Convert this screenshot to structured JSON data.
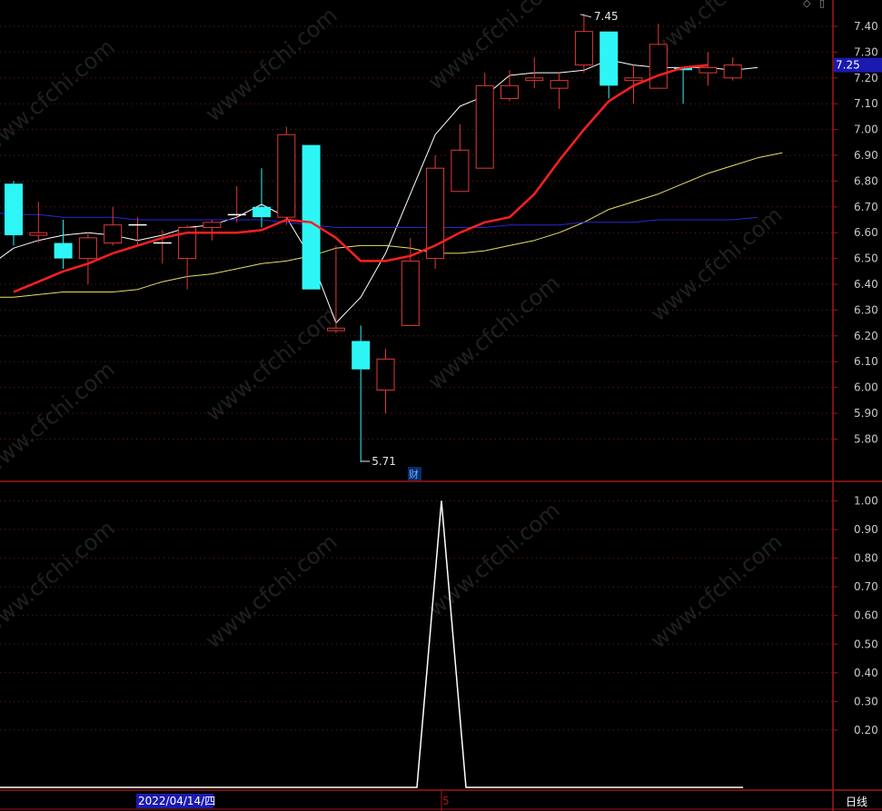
{
  "chart_data": [
    {
      "type": "candlestick",
      "panel": "price",
      "ylim": [
        5.7,
        7.5
      ],
      "yticks": [
        "7.40",
        "7.30",
        "7.20",
        "7.10",
        "7.00",
        "6.90",
        "6.80",
        "6.70",
        "6.60",
        "6.50",
        "6.40",
        "6.30",
        "6.20",
        "6.10",
        "6.00",
        "5.90",
        "5.80"
      ],
      "last_price_label": "7.25",
      "max_label": "7.45",
      "min_label": "5.71",
      "event_badge": "财",
      "candles": [
        {
          "o": 6.79,
          "h": 6.8,
          "l": 6.55,
          "c": 6.59
        },
        {
          "o": 6.59,
          "h": 6.72,
          "l": 6.56,
          "c": 6.6
        },
        {
          "o": 6.56,
          "h": 6.65,
          "l": 6.46,
          "c": 6.5
        },
        {
          "o": 6.5,
          "h": 6.6,
          "l": 6.4,
          "c": 6.58
        },
        {
          "o": 6.56,
          "h": 6.7,
          "l": 6.55,
          "c": 6.63
        },
        {
          "o": 6.63,
          "h": 6.66,
          "l": 6.55,
          "c": 6.63
        },
        {
          "o": 6.56,
          "h": 6.61,
          "l": 6.48,
          "c": 6.56
        },
        {
          "o": 6.5,
          "h": 6.63,
          "l": 6.38,
          "c": 6.62
        },
        {
          "o": 6.62,
          "h": 6.65,
          "l": 6.57,
          "c": 6.64
        },
        {
          "o": 6.67,
          "h": 6.78,
          "l": 6.64,
          "c": 6.67
        },
        {
          "o": 6.7,
          "h": 6.85,
          "l": 6.62,
          "c": 6.66
        },
        {
          "o": 6.66,
          "h": 7.01,
          "l": 6.63,
          "c": 6.98
        },
        {
          "o": 6.94,
          "h": 6.94,
          "l": 6.38,
          "c": 6.38
        },
        {
          "o": 6.22,
          "h": 6.55,
          "l": 6.21,
          "c": 6.23
        },
        {
          "o": 6.18,
          "h": 6.24,
          "l": 5.71,
          "c": 6.07
        },
        {
          "o": 5.99,
          "h": 6.15,
          "l": 5.9,
          "c": 6.11
        },
        {
          "o": 6.24,
          "h": 6.58,
          "l": 6.24,
          "c": 6.49
        },
        {
          "o": 6.5,
          "h": 6.9,
          "l": 6.46,
          "c": 6.85
        },
        {
          "o": 6.76,
          "h": 7.02,
          "l": 6.76,
          "c": 6.92
        },
        {
          "o": 6.85,
          "h": 7.22,
          "l": 6.85,
          "c": 7.17
        },
        {
          "o": 7.12,
          "h": 7.23,
          "l": 7.11,
          "c": 7.17
        },
        {
          "o": 7.19,
          "h": 7.28,
          "l": 7.16,
          "c": 7.2
        },
        {
          "o": 7.16,
          "h": 7.22,
          "l": 7.08,
          "c": 7.19
        },
        {
          "o": 7.25,
          "h": 7.45,
          "l": 7.22,
          "c": 7.38
        },
        {
          "o": 7.38,
          "h": 7.38,
          "l": 7.12,
          "c": 7.17
        },
        {
          "o": 7.19,
          "h": 7.25,
          "l": 7.1,
          "c": 7.2
        },
        {
          "o": 7.16,
          "h": 7.41,
          "l": 7.16,
          "c": 7.33
        },
        {
          "o": 7.24,
          "h": 7.24,
          "l": 7.1,
          "c": 7.23
        },
        {
          "o": 7.22,
          "h": 7.3,
          "l": 7.17,
          "c": 7.24
        },
        {
          "o": 7.2,
          "h": 7.28,
          "l": 7.19,
          "c": 7.25
        }
      ],
      "series": [
        {
          "color": "#ffffff",
          "width": 1,
          "values": [
            6.47,
            6.54,
            6.57,
            6.59,
            6.6,
            6.59,
            6.57,
            6.59,
            6.62,
            6.63,
            6.66,
            6.71,
            6.66,
            6.5,
            6.25,
            6.35,
            6.52,
            6.75,
            6.98,
            7.09,
            7.13,
            7.21,
            7.22,
            7.22,
            7.23,
            7.27,
            7.25,
            7.24,
            7.24,
            7.24,
            7.23,
            7.24
          ]
        },
        {
          "color": "#ff2020",
          "width": 2.5,
          "values": [
            6.37,
            6.41,
            6.45,
            6.48,
            6.52,
            6.55,
            6.58,
            6.6,
            6.6,
            6.6,
            6.61,
            6.65,
            6.64,
            6.58,
            6.49,
            6.49,
            6.51,
            6.55,
            6.6,
            6.64,
            6.66,
            6.75,
            6.88,
            7.0,
            7.11,
            7.17,
            7.21,
            7.24,
            7.25
          ]
        },
        {
          "color": "#e6e066",
          "width": 1,
          "values": [
            6.35,
            6.35,
            6.36,
            6.37,
            6.37,
            6.37,
            6.38,
            6.41,
            6.43,
            6.44,
            6.46,
            6.48,
            6.49,
            6.51,
            6.54,
            6.55,
            6.55,
            6.54,
            6.52,
            6.52,
            6.53,
            6.55,
            6.57,
            6.6,
            6.64,
            6.69,
            6.72,
            6.75,
            6.79,
            6.83,
            6.86,
            6.89,
            6.91
          ]
        },
        {
          "color": "#2828d8",
          "width": 1,
          "values": [
            6.68,
            6.67,
            6.67,
            6.66,
            6.66,
            6.66,
            6.65,
            6.65,
            6.65,
            6.65,
            6.65,
            6.65,
            6.64,
            6.63,
            6.62,
            6.62,
            6.62,
            6.62,
            6.62,
            6.62,
            6.62,
            6.63,
            6.63,
            6.63,
            6.64,
            6.64,
            6.64,
            6.65,
            6.65,
            6.65,
            6.65,
            6.66
          ]
        }
      ]
    },
    {
      "type": "line",
      "panel": "indicator",
      "ylim": [
        0,
        1.05
      ],
      "yticks": [
        "1.00",
        "0.90",
        "0.80",
        "0.70",
        "0.60",
        "0.50",
        "0.40",
        "0.30",
        "0.20"
      ],
      "series": [
        {
          "color": "#ffffff",
          "points": [
            [
              0,
              0
            ],
            [
              17,
              0
            ],
            [
              18,
              1
            ],
            [
              19,
              0
            ],
            [
              31,
              0
            ]
          ]
        }
      ]
    }
  ],
  "x_axis": {
    "date_label": "2022/04/14/四",
    "marker_label": "5"
  },
  "period_label": "日线",
  "watermark_text": "www.cfchi.com",
  "icons": [
    "diamond-icon",
    "scroll-icon"
  ]
}
